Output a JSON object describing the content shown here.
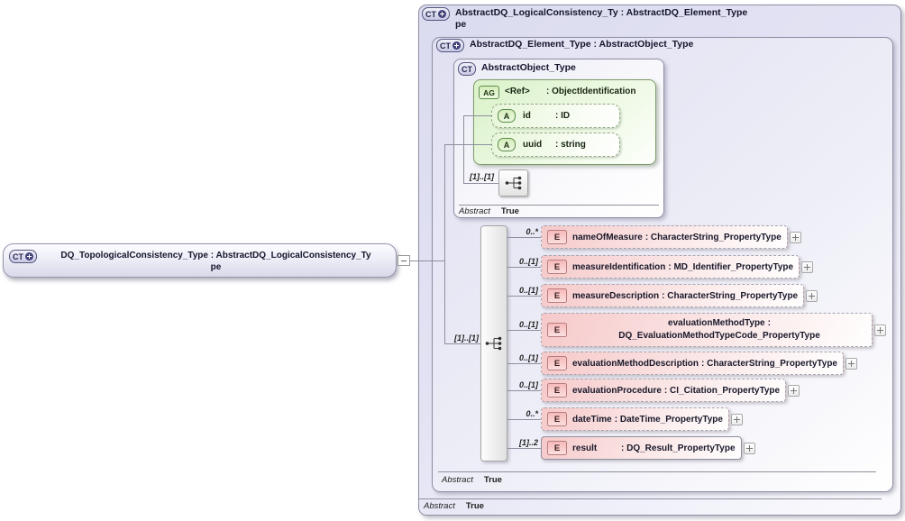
{
  "left_box": {
    "icon": "CT",
    "title_line1": "DQ_TopologicalConsistency_Type : AbstractDQ_LogicalConsistency_Ty",
    "title_line2": "pe"
  },
  "outer_panel": {
    "icon": "CT",
    "title_line1": "AbstractDQ_LogicalConsistency_Ty : AbstractDQ_Element_Type",
    "title_line2": "pe",
    "abstract_label": "Abstract",
    "abstract_value": "True"
  },
  "inner_panel": {
    "icon": "CT",
    "title": "AbstractDQ_Element_Type : AbstractObject_Type",
    "abstract_label": "Abstract",
    "abstract_value": "True"
  },
  "object_box": {
    "icon": "CT",
    "title": "AbstractObject_Type",
    "abstract_label": "Abstract",
    "abstract_value": "True",
    "attribute_group": {
      "icon": "AG",
      "name": "<Ref>",
      "type": ": ObjectIdentification",
      "attributes": [
        {
          "icon": "A",
          "name": "id",
          "type": ": ID"
        },
        {
          "icon": "A",
          "name": "uuid",
          "type": ": string"
        }
      ]
    },
    "content_cardinality": "[1]..[1]"
  },
  "sequence": {
    "cardinality": "[1]..[1]"
  },
  "elements": [
    {
      "icon": "E",
      "cardinality": "0..*",
      "name": "nameOfMeasure",
      "type": ": CharacterString_PropertyType"
    },
    {
      "icon": "E",
      "cardinality": "0..[1]",
      "name": "measureIdentification",
      "type": ": MD_Identifier_PropertyType"
    },
    {
      "icon": "E",
      "cardinality": "0..[1]",
      "name": "measureDescription",
      "type": ": CharacterString_PropertyType"
    },
    {
      "icon": "E",
      "cardinality": "0..[1]",
      "name": "evaluationMethodType",
      "type": ": DQ_EvaluationMethodTypeCode_PropertyType"
    },
    {
      "icon": "E",
      "cardinality": "0..[1]",
      "name": "evaluationMethodDescription",
      "type": ": CharacterString_PropertyType"
    },
    {
      "icon": "E",
      "cardinality": "0..[1]",
      "name": "evaluationProcedure",
      "type": ": CI_Citation_PropertyType"
    },
    {
      "icon": "E",
      "cardinality": "0..*",
      "name": "dateTime",
      "type": ": DateTime_PropertyType"
    },
    {
      "icon": "E",
      "cardinality": "[1]..2",
      "name": "result",
      "type": ": DQ_Result_PropertyType"
    }
  ]
}
